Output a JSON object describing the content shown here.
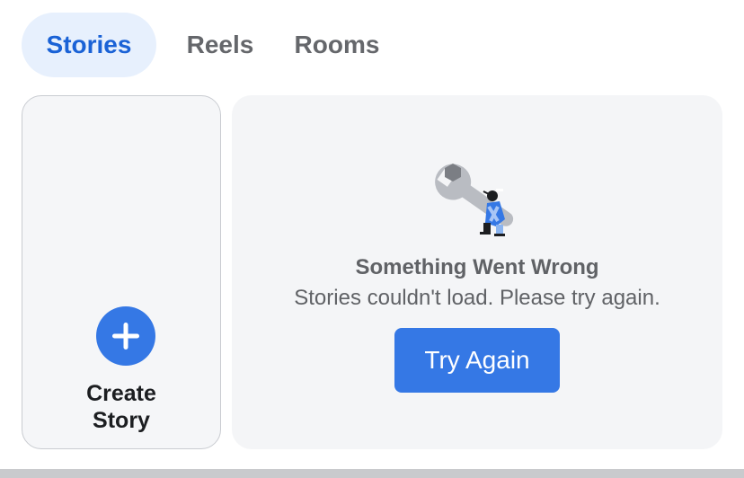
{
  "tabs": [
    {
      "label": "Stories",
      "active": true
    },
    {
      "label": "Reels",
      "active": false
    },
    {
      "label": "Rooms",
      "active": false
    }
  ],
  "create_story": {
    "line1": "Create",
    "line2": "Story",
    "icon": "plus-icon"
  },
  "error": {
    "illustration": "wrench-worker-icon",
    "title": "Something Went Wrong",
    "message": "Stories couldn't load. Please try again.",
    "button_label": "Try Again"
  },
  "colors": {
    "accent": "#3578e5",
    "active_tab_bg": "#e7f0fd",
    "active_tab_text": "#1a62d6",
    "muted_text": "#65676b"
  }
}
